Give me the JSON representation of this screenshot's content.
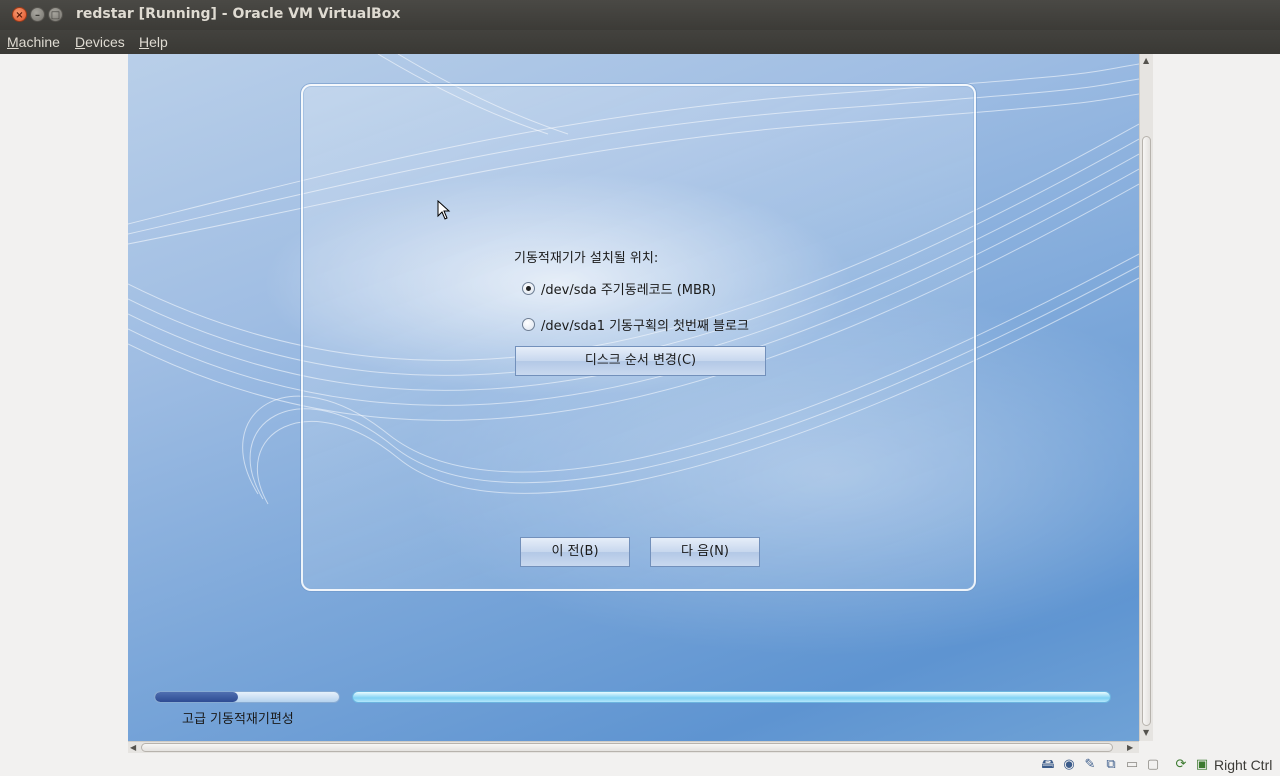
{
  "window": {
    "title": "redstar [Running] - Oracle VM VirtualBox",
    "buttons": {
      "close": "×",
      "minimize": "–",
      "maximize": "□"
    }
  },
  "menubar": {
    "items": [
      {
        "label": "Machine"
      },
      {
        "label": "Devices"
      },
      {
        "label": "Help"
      }
    ]
  },
  "installer": {
    "prompt": "기동적재기가 설치될 위치:",
    "options": [
      {
        "label": "/dev/sda 주기동레코드 (MBR)",
        "selected": true
      },
      {
        "label": "/dev/sda1 기동구획의 첫번째 블로크",
        "selected": false
      }
    ],
    "change_disk_order_button": "디스크 순서 변경(C)",
    "back_button": "이 전(B)",
    "next_button": "다 음(N)",
    "step_label": "고급 기동적재기편성",
    "progress_fraction": 0.45
  },
  "statusbar": {
    "icons": [
      "hard-disk-icon",
      "cd-icon",
      "usb-icon",
      "network-icon",
      "shared-folders-icon",
      "video-capture-icon",
      "virtualization-icon",
      "mouse-integration-icon"
    ],
    "host_key": "Right Ctrl"
  }
}
